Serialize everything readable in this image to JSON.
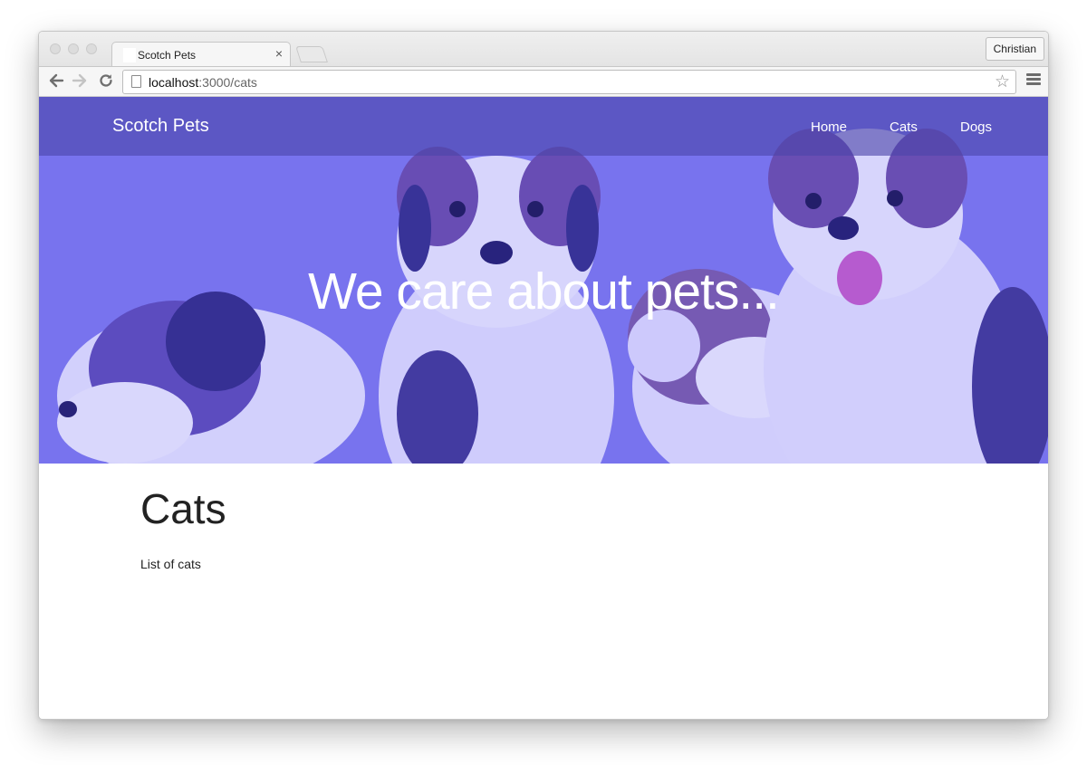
{
  "browser": {
    "tab_title": "Scotch Pets",
    "tab_close": "×",
    "profile_name": "Christian",
    "url_host": "localhost",
    "url_rest": ":3000/cats"
  },
  "site": {
    "brand": "Scotch Pets",
    "nav": [
      "Home",
      "Cats",
      "Dogs"
    ],
    "hero_heading": "We care about pets...",
    "hero_overlay_color": "#7c78ee"
  },
  "content": {
    "title": "Cats",
    "text": "List of cats"
  }
}
